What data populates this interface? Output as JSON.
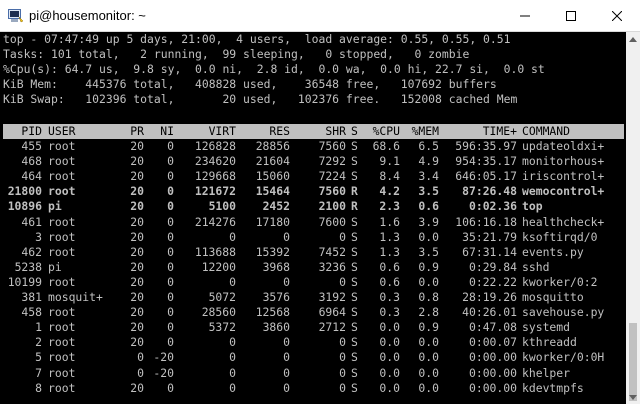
{
  "window": {
    "title": "pi@housemonitor: ~",
    "icon": "putty-terminal-icon"
  },
  "summary": {
    "line1": "top - 07:47:49 up 5 days, 21:00,  4 users,  load average: 0.55, 0.55, 0.51",
    "line2": "Tasks: 101 total,   2 running,  99 sleeping,   0 stopped,   0 zombie",
    "line3": "%Cpu(s): 64.7 us,  9.8 sy,  0.0 ni,  2.8 id,  0.0 wa,  0.0 hi, 22.7 si,  0.0 st",
    "line4": "KiB Mem:    445376 total,   408828 used,    36548 free,   107692 buffers",
    "line5": "KiB Swap:   102396 total,       20 used,   102376 free.   152008 cached Mem"
  },
  "columns": [
    "PID",
    "USER",
    "PR",
    "NI",
    "VIRT",
    "RES",
    "SHR",
    "S",
    "%CPU",
    "%MEM",
    "TIME+",
    "COMMAND"
  ],
  "processes": [
    {
      "pid": "455",
      "user": "root",
      "pr": "20",
      "ni": "0",
      "virt": "126828",
      "res": "28856",
      "shr": "7560",
      "s": "S",
      "cpu": "68.6",
      "mem": "6.5",
      "time": "596:35.97",
      "cmd": "updateoldxi+",
      "bold": false
    },
    {
      "pid": "468",
      "user": "root",
      "pr": "20",
      "ni": "0",
      "virt": "234620",
      "res": "21604",
      "shr": "7292",
      "s": "S",
      "cpu": "9.1",
      "mem": "4.9",
      "time": "954:35.17",
      "cmd": "monitorhous+",
      "bold": false
    },
    {
      "pid": "464",
      "user": "root",
      "pr": "20",
      "ni": "0",
      "virt": "129668",
      "res": "15060",
      "shr": "7224",
      "s": "S",
      "cpu": "8.4",
      "mem": "3.4",
      "time": "646:05.17",
      "cmd": "iriscontrol+",
      "bold": false
    },
    {
      "pid": "21800",
      "user": "root",
      "pr": "20",
      "ni": "0",
      "virt": "121672",
      "res": "15464",
      "shr": "7560",
      "s": "R",
      "cpu": "4.2",
      "mem": "3.5",
      "time": "87:26.48",
      "cmd": "wemocontrol+",
      "bold": true
    },
    {
      "pid": "10896",
      "user": "pi",
      "pr": "20",
      "ni": "0",
      "virt": "5100",
      "res": "2452",
      "shr": "2100",
      "s": "R",
      "cpu": "2.3",
      "mem": "0.6",
      "time": "0:02.36",
      "cmd": "top",
      "bold": true
    },
    {
      "pid": "461",
      "user": "root",
      "pr": "20",
      "ni": "0",
      "virt": "214276",
      "res": "17180",
      "shr": "7600",
      "s": "S",
      "cpu": "1.6",
      "mem": "3.9",
      "time": "106:16.18",
      "cmd": "healthcheck+",
      "bold": false
    },
    {
      "pid": "3",
      "user": "root",
      "pr": "20",
      "ni": "0",
      "virt": "0",
      "res": "0",
      "shr": "0",
      "s": "S",
      "cpu": "1.3",
      "mem": "0.0",
      "time": "35:21.79",
      "cmd": "ksoftirqd/0",
      "bold": false
    },
    {
      "pid": "462",
      "user": "root",
      "pr": "20",
      "ni": "0",
      "virt": "113688",
      "res": "15392",
      "shr": "7452",
      "s": "S",
      "cpu": "1.3",
      "mem": "3.5",
      "time": "67:31.14",
      "cmd": "events.py",
      "bold": false
    },
    {
      "pid": "5238",
      "user": "pi",
      "pr": "20",
      "ni": "0",
      "virt": "12200",
      "res": "3968",
      "shr": "3236",
      "s": "S",
      "cpu": "0.6",
      "mem": "0.9",
      "time": "0:29.84",
      "cmd": "sshd",
      "bold": false
    },
    {
      "pid": "10199",
      "user": "root",
      "pr": "20",
      "ni": "0",
      "virt": "0",
      "res": "0",
      "shr": "0",
      "s": "S",
      "cpu": "0.6",
      "mem": "0.0",
      "time": "0:22.22",
      "cmd": "kworker/0:2",
      "bold": false
    },
    {
      "pid": "381",
      "user": "mosquit+",
      "pr": "20",
      "ni": "0",
      "virt": "5072",
      "res": "3576",
      "shr": "3192",
      "s": "S",
      "cpu": "0.3",
      "mem": "0.8",
      "time": "28:19.26",
      "cmd": "mosquitto",
      "bold": false
    },
    {
      "pid": "458",
      "user": "root",
      "pr": "20",
      "ni": "0",
      "virt": "28560",
      "res": "12568",
      "shr": "6964",
      "s": "S",
      "cpu": "0.3",
      "mem": "2.8",
      "time": "40:26.01",
      "cmd": "savehouse.py",
      "bold": false
    },
    {
      "pid": "1",
      "user": "root",
      "pr": "20",
      "ni": "0",
      "virt": "5372",
      "res": "3860",
      "shr": "2712",
      "s": "S",
      "cpu": "0.0",
      "mem": "0.9",
      "time": "0:47.08",
      "cmd": "systemd",
      "bold": false
    },
    {
      "pid": "2",
      "user": "root",
      "pr": "20",
      "ni": "0",
      "virt": "0",
      "res": "0",
      "shr": "0",
      "s": "S",
      "cpu": "0.0",
      "mem": "0.0",
      "time": "0:00.07",
      "cmd": "kthreadd",
      "bold": false
    },
    {
      "pid": "5",
      "user": "root",
      "pr": "0",
      "ni": "-20",
      "virt": "0",
      "res": "0",
      "shr": "0",
      "s": "S",
      "cpu": "0.0",
      "mem": "0.0",
      "time": "0:00.00",
      "cmd": "kworker/0:0H",
      "bold": false
    },
    {
      "pid": "7",
      "user": "root",
      "pr": "0",
      "ni": "-20",
      "virt": "0",
      "res": "0",
      "shr": "0",
      "s": "S",
      "cpu": "0.0",
      "mem": "0.0",
      "time": "0:00.00",
      "cmd": "khelper",
      "bold": false
    },
    {
      "pid": "8",
      "user": "root",
      "pr": "20",
      "ni": "0",
      "virt": "0",
      "res": "0",
      "shr": "0",
      "s": "S",
      "cpu": "0.0",
      "mem": "0.0",
      "time": "0:00.00",
      "cmd": "kdevtmpfs",
      "bold": false
    }
  ],
  "colors": {
    "terminal_bg": "#000000",
    "terminal_fg": "#c0c0c0",
    "bold_fg": "#ffffff",
    "header_bar": "#c0c0c0"
  }
}
